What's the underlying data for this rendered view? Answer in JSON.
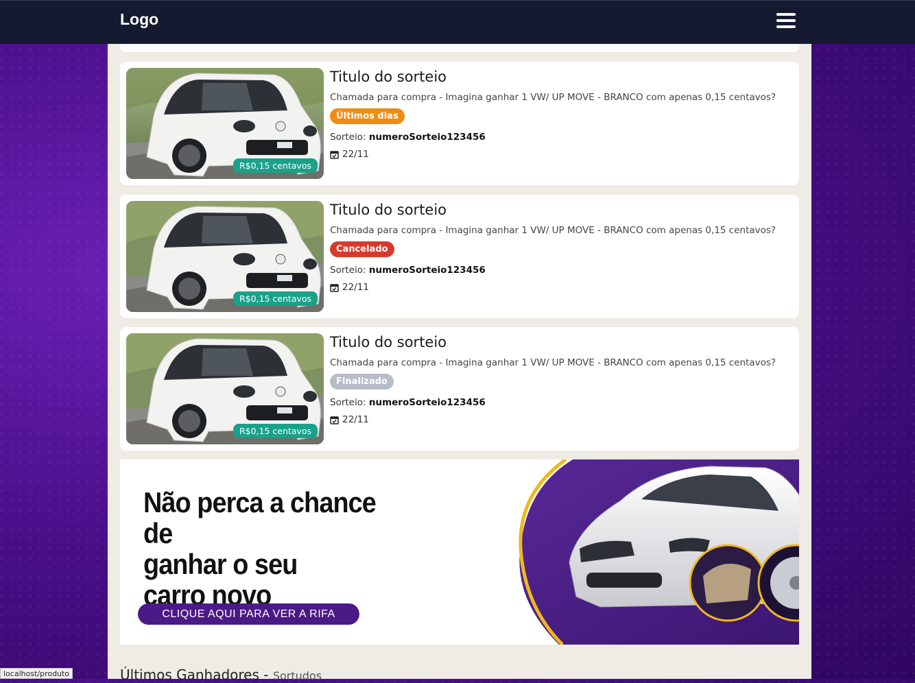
{
  "header": {
    "logo": "Logo"
  },
  "cards": [
    {
      "title": "Titulo do sorteio",
      "description": "Chamada para compra - Imagina ganhar 1 VW/ UP MOVE - BRANCO com apenas 0,15 centavos?",
      "badge": "Últimos dias",
      "badge_color": "#ef8c12",
      "number_label": "Sorteio:",
      "number": "numeroSorteio123456",
      "date": "22/11",
      "price": "R$0,15 centavos"
    },
    {
      "title": "Titulo do sorteio",
      "description": "Chamada para compra - Imagina ganhar 1 VW/ UP MOVE - BRANCO com apenas 0,15 centavos?",
      "badge": "Cancelado",
      "badge_color": "#d63a2c",
      "number_label": "Sorteio:",
      "number": "numeroSorteio123456",
      "date": "22/11",
      "price": "R$0,15 centavos"
    },
    {
      "title": "Titulo do sorteio",
      "description": "Chamada para compra - Imagina ganhar 1 VW/ UP MOVE - BRANCO com apenas 0,15 centavos?",
      "badge": "Finalizado",
      "badge_color": "#b7bcc6",
      "number_label": "Sorteio:",
      "number": "numeroSorteio123456",
      "date": "22/11",
      "price": "R$0,15 centavos"
    }
  ],
  "banner": {
    "headline_line1": "Não perca a chance de",
    "headline_line2": "ganhar o seu",
    "headline_line3": "carro novo",
    "cta": "CLIQUE AQUI PARA VER A RIFA"
  },
  "winners": {
    "title": "Últimos Ganhadores",
    "separator": "-",
    "subtitle": "Sortudos"
  },
  "status_bar": {
    "url": "localhost/produto"
  },
  "icons": {
    "menu": "hamburger-icon",
    "date": "calendar-check-icon"
  },
  "colors": {
    "header_bg": "#161a30",
    "price_tag": "#1aa18a",
    "cta_bg": "#4b1a86",
    "banner_purple": "#4a1e86",
    "ring_gold": "#f0b81e"
  }
}
